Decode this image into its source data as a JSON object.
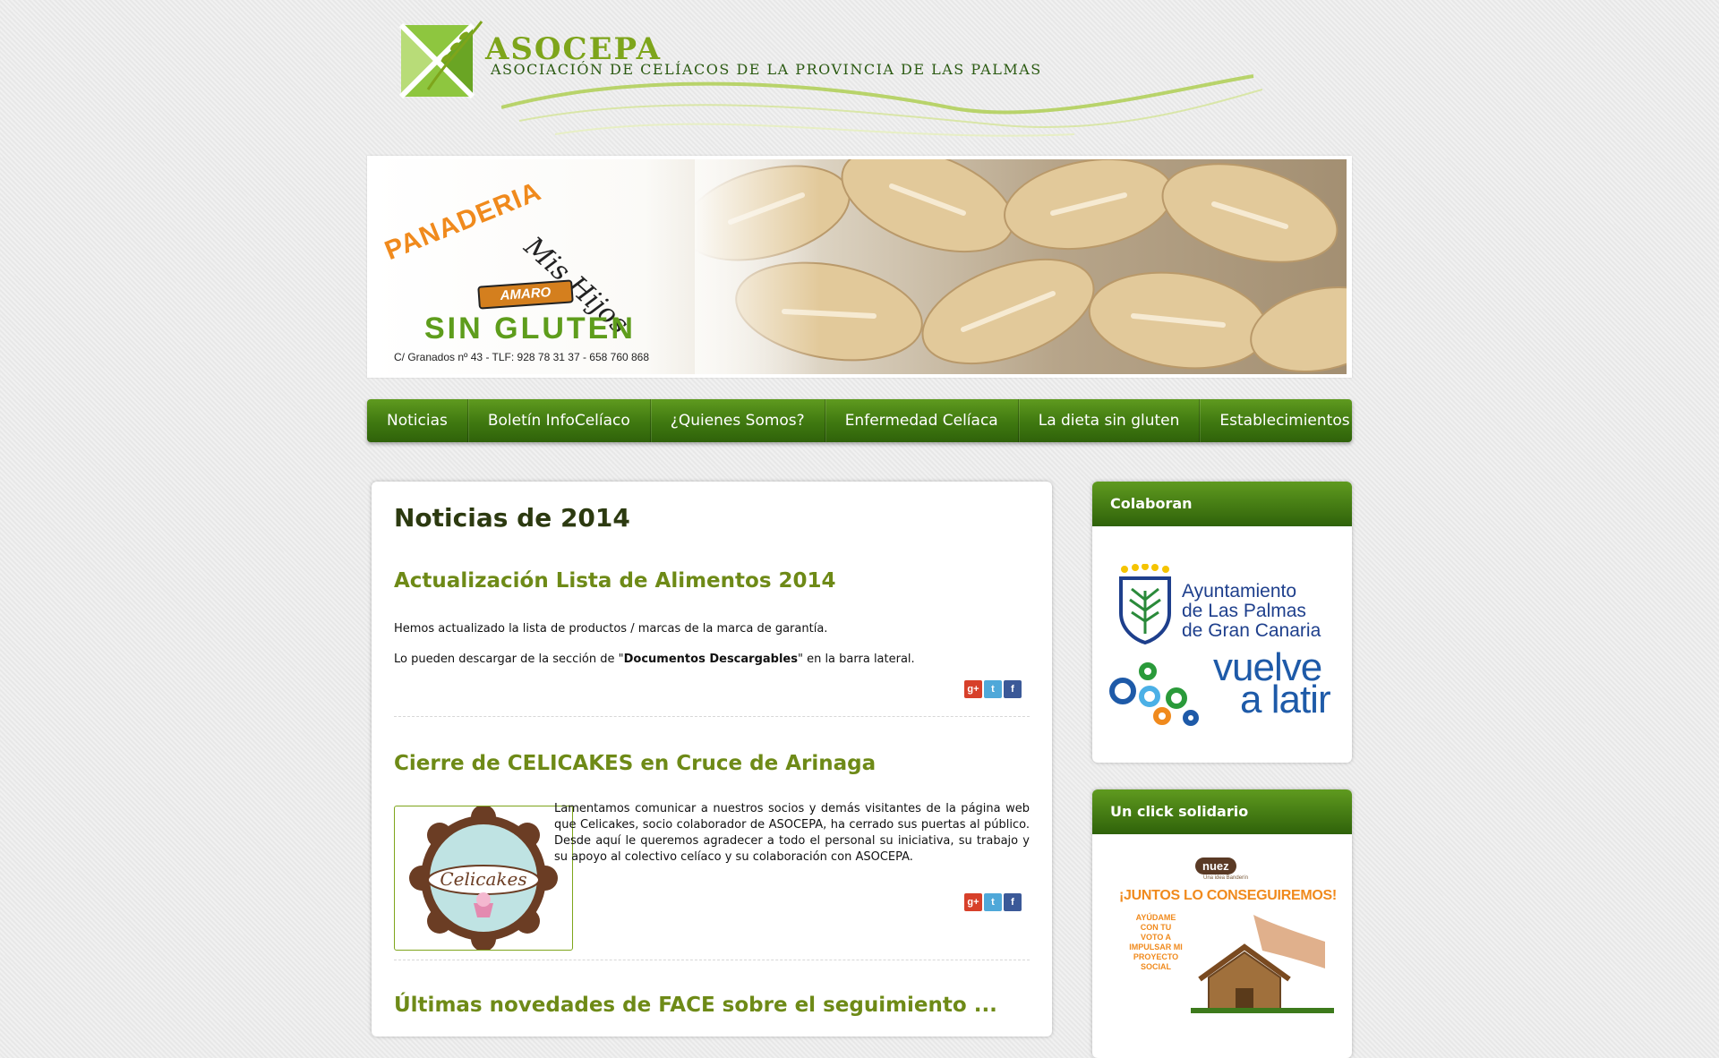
{
  "header": {
    "brand_name": "ASOCEPA",
    "brand_subtitle": "ASOCIACIÓN DE CELÍACOS DE LA PROVINCIA DE LAS PALMAS"
  },
  "banner": {
    "panaderia": "PANADERIA",
    "mis_hijos": "Mis Hijos",
    "amaro": "AMARO",
    "sin_gluten": "SIN GLUTEN",
    "address": "C/ Granados nº 43 - TLF: 928 78 31 37 - 658 760 868"
  },
  "nav": {
    "items": [
      {
        "label": "Noticias"
      },
      {
        "label": "Boletín InfoCelíaco"
      },
      {
        "label": "¿Quienes Somos?"
      },
      {
        "label": "Enfermedad Celíaca"
      },
      {
        "label": "La dieta sin gluten"
      },
      {
        "label": "Establecimientos"
      }
    ]
  },
  "main": {
    "page_title": "Noticias de 2014",
    "posts": [
      {
        "title": "Actualización Lista de Alimentos 2014",
        "p1": "Hemos actualizado la lista de productos / marcas de la marca de garantía.",
        "p2_before": "Lo pueden descargar de la sección de \"",
        "p2_bold": "Documentos Descargables",
        "p2_after": "\" en la barra lateral."
      },
      {
        "title": "Cierre de CELICAKES en Cruce de Arinaga",
        "text": "Lamentamos comunicar a nuestros socios y demás visitantes de la página web que Celicakes, socio colaborador de ASOCEPA, ha cerrado sus puertas al público. Desde aquí le queremos agradecer a todo el personal su iniciativa, su trabajo y su apoyo al colectivo celíaco y su colaboración con ASOCEPA.",
        "image_label": "Celicakes"
      },
      {
        "title": "Últimas novedades de FACE sobre el seguimiento ..."
      }
    ],
    "share": {
      "gplus": "g+",
      "twitter": "t",
      "facebook": "f"
    }
  },
  "sidebar": {
    "colaboran": {
      "title": "Colaboran",
      "ayuntamiento": [
        "Ayuntamiento",
        "de Las Palmas",
        "de Gran Canaria"
      ],
      "vuelve": [
        "vuelve",
        "a latir"
      ]
    },
    "click_solidario": {
      "title": "Un click solidario",
      "nuez": "nuez",
      "nuez_tagline": "Una idea Banderín",
      "headline": "¡JUNTOS LO CONSEGUIREMOS!",
      "ayudame": "AYÚDAME CON TU VOTO A IMPULSAR MI PROYECTO SOCIAL"
    }
  },
  "colors": {
    "accent_green": "#5e9d1c",
    "title_green": "#6e8a17",
    "orange": "#f08a1d",
    "blue": "#1e3f8c"
  }
}
